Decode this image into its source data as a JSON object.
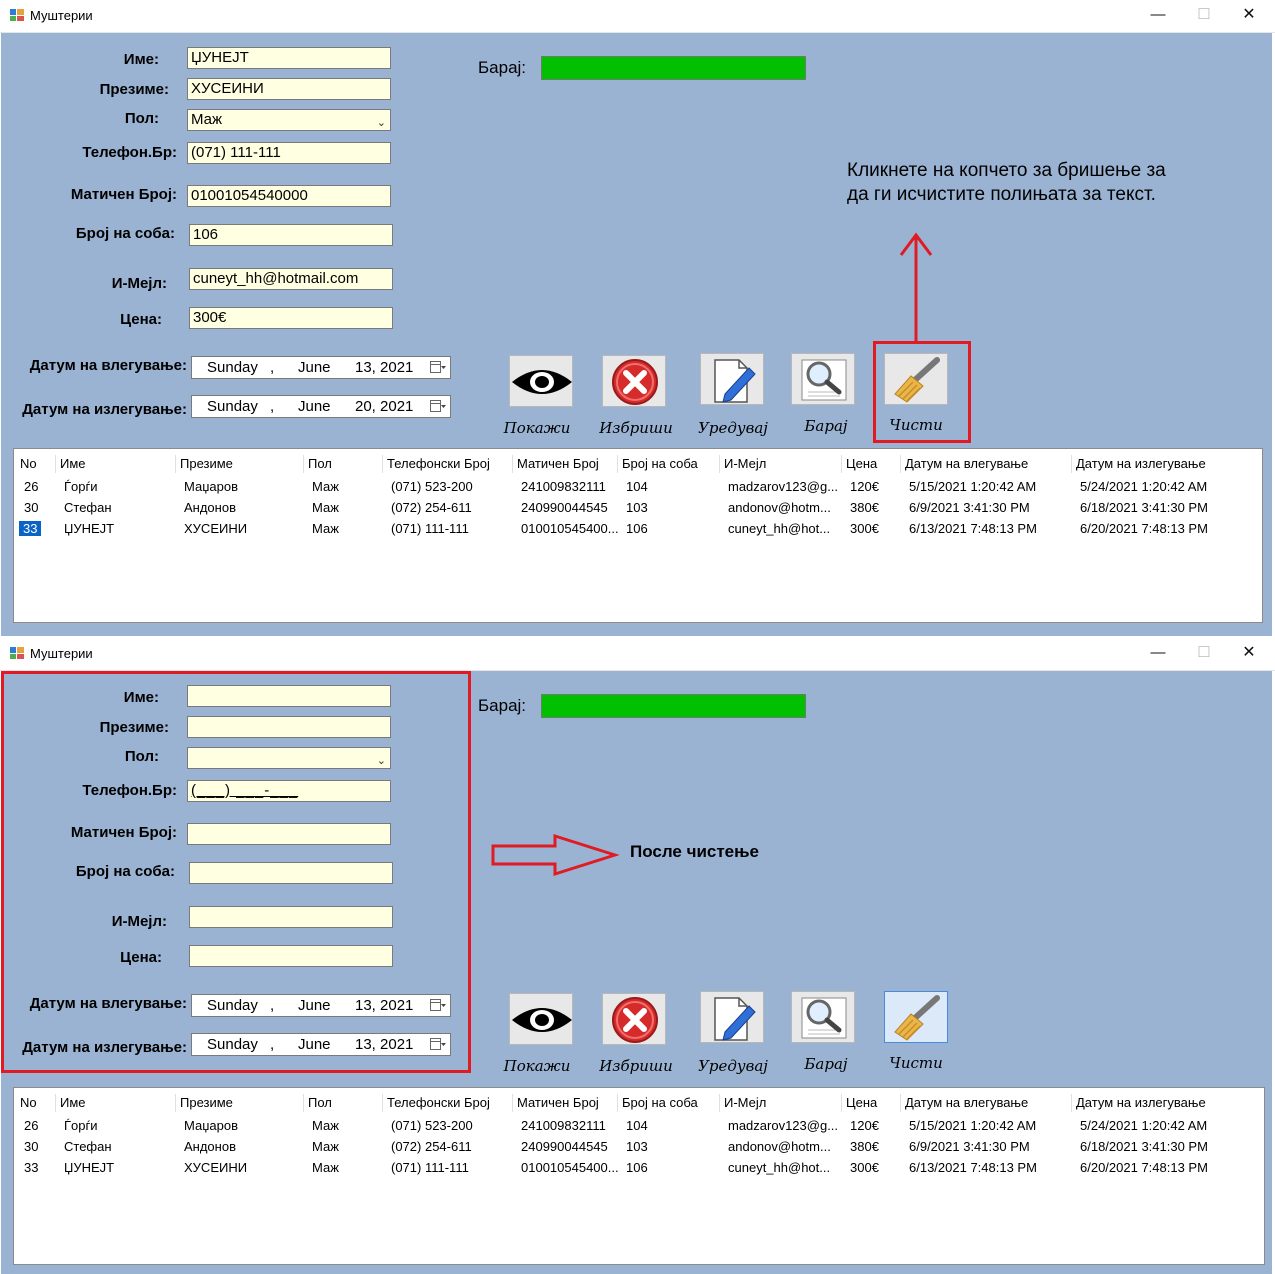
{
  "window_title": "Муштерии",
  "labels": {
    "name": "Име:",
    "surname": "Презиме:",
    "gender": "Пол:",
    "phone": "Телефон.Бр:",
    "embg": "Матичен Број:",
    "room": "Број на соба:",
    "email": "И-Мејл:",
    "price": "Цена:",
    "checkin": "Датум на влегување:",
    "checkout": "Датум на излегување:",
    "search": "Барај:"
  },
  "buttons": {
    "show": "Покажи",
    "delete": "Избриши",
    "edit": "Уредувај",
    "search": "Барај",
    "clear": "Чисти"
  },
  "annotations": {
    "note_line1": "Кликнете на копчето за бришење за",
    "note_line2": "да ги исчистите полињата за текст.",
    "after_clear": "После чистење"
  },
  "before": {
    "name": "ЏУНЕЈТ",
    "surname": "ХУСЕИНИ",
    "gender": "Маж",
    "phone": "(071) 111-111",
    "embg": "01001054540000",
    "room": "106",
    "email": "cuneyt_hh@hotmail.com",
    "price": "300€",
    "checkin": {
      "day": "Sunday",
      "month": "June",
      "date": "13, 2021"
    },
    "checkout": {
      "day": "Sunday",
      "month": "June",
      "date": "20, 2021"
    }
  },
  "after": {
    "name": "",
    "surname": "",
    "gender": "",
    "phone": "(___) ___-___",
    "embg": "",
    "room": "",
    "email": "",
    "price": "",
    "checkin": {
      "day": "Sunday",
      "month": "June",
      "date": "13, 2021"
    },
    "checkout": {
      "day": "Sunday",
      "month": "June",
      "date": "13, 2021"
    }
  },
  "table": {
    "columns": [
      "No",
      "Име",
      "Презиме",
      "Пол",
      "Телефонски Број",
      "Матичен Број",
      "Број на соба",
      "И-Мејл",
      "Цена",
      "Датум на влегување",
      "Датум на излегување"
    ],
    "rows": [
      [
        "26",
        "Ѓорѓи",
        "Маџаров",
        "Маж",
        "(071) 523-200",
        "241009832111",
        "104",
        "madzarov123@g...",
        "120€",
        "5/15/2021 1:20:42 AM",
        "5/24/2021 1:20:42 AM"
      ],
      [
        "30",
        "Стефан",
        "Андонов",
        "Маж",
        "(072) 254-611",
        "240990044545",
        "103",
        "andonov@hotm...",
        "380€",
        "6/9/2021 3:41:30 PM",
        "6/18/2021 3:41:30 PM"
      ],
      [
        "33",
        "ЏУНЕЈТ",
        "ХУСЕИНИ",
        "Маж",
        "(071) 111-111",
        "010010545400...",
        "106",
        "cuneyt_hh@hot...",
        "300€",
        "6/13/2021 7:48:13 PM",
        "6/20/2021 7:48:13 PM"
      ]
    ]
  },
  "colors": {
    "client_bg": "#9ab3d2",
    "field_bg": "#ffffe1",
    "search_box": "#00c000",
    "highlight": "#e01b24"
  }
}
